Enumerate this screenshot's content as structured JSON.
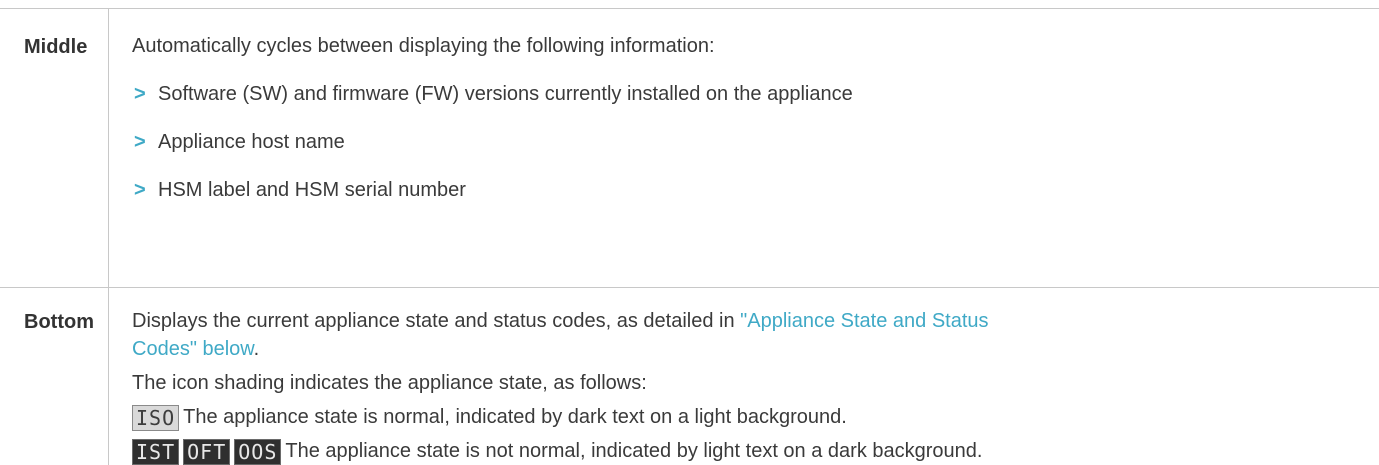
{
  "rows": [
    {
      "label": "Middle",
      "intro": "Automatically cycles between displaying the following information:",
      "bullets": [
        "Software (SW) and firmware (FW) versions currently installed on the appliance",
        "Appliance host name",
        "HSM label and HSM serial number"
      ]
    },
    {
      "label": "Bottom",
      "line1_before_link": "Displays the current appliance state and status codes, as detailed in ",
      "link_line1": "\"Appliance State and Status",
      "link_line2": "Codes\" below",
      "line2_after_link": ".",
      "shading_intro": "The icon shading indicates the appliance state, as follows:",
      "normal_icon": "ISO",
      "normal_text": "The appliance state is normal, indicated by dark text on a light background.",
      "abnormal_icons": [
        "IST",
        "OFT",
        "OOS"
      ],
      "abnormal_text": "The appliance state is not normal, indicated by light text on a dark background."
    }
  ],
  "bullet_glyph": ">",
  "colors": {
    "link": "#3fa9c6",
    "bullet": "#3fa9c6",
    "text": "#3a3a3a",
    "rule": "#c8c8c8"
  }
}
